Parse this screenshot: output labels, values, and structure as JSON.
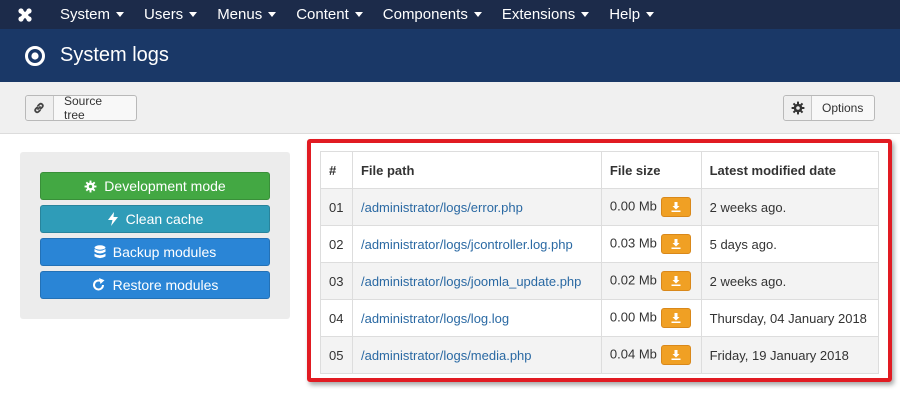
{
  "nav": {
    "items": [
      {
        "label": "System"
      },
      {
        "label": "Users"
      },
      {
        "label": "Menus"
      },
      {
        "label": "Content"
      },
      {
        "label": "Components"
      },
      {
        "label": "Extensions"
      },
      {
        "label": "Help"
      }
    ]
  },
  "header": {
    "title": "System logs"
  },
  "toolbar": {
    "source_tree_label": "Source tree",
    "options_label": "Options"
  },
  "actions": {
    "development_mode": "Development mode",
    "clean_cache": "Clean cache",
    "backup_modules": "Backup modules",
    "restore_modules": "Restore modules"
  },
  "colors": {
    "nav_bg": "#1c2b4a",
    "header_bg": "#1a3867",
    "green": "#43a843",
    "teal": "#2f9cb8",
    "blue": "#2a85d6",
    "orange": "#f0a024",
    "highlight": "#e11b22"
  },
  "table": {
    "headers": {
      "num": "#",
      "path": "File path",
      "size": "File size",
      "date": "Latest modified date"
    },
    "rows": [
      {
        "num": "01",
        "path": "/administrator/logs/error.php",
        "size": "0.00 Mb",
        "date": "2 weeks ago."
      },
      {
        "num": "02",
        "path": "/administrator/logs/jcontroller.log.php",
        "size": "0.03 Mb",
        "date": "5 days ago."
      },
      {
        "num": "03",
        "path": "/administrator/logs/joomla_update.php",
        "size": "0.02 Mb",
        "date": "2 weeks ago."
      },
      {
        "num": "04",
        "path": "/administrator/logs/log.log",
        "size": "0.00 Mb",
        "date": "Thursday, 04 January 2018"
      },
      {
        "num": "05",
        "path": "/administrator/logs/media.php",
        "size": "0.04 Mb",
        "date": "Friday, 19 January 2018"
      }
    ]
  }
}
